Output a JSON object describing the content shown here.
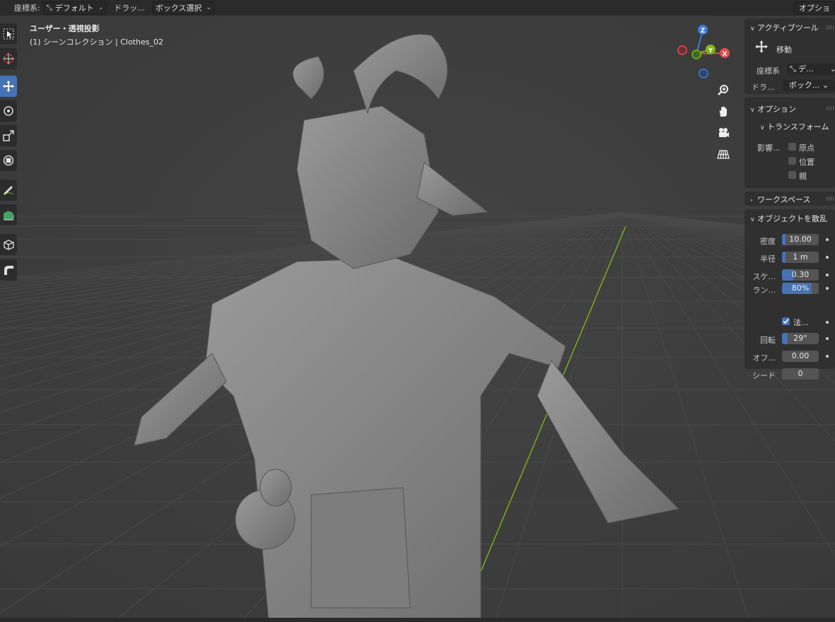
{
  "header": {
    "coord_label": "座標系:",
    "coord_value": "デフォルト",
    "drag_label": "ドラッ...",
    "drag_value": "ボックス選択",
    "options_label": "オプショ"
  },
  "viewport": {
    "view_title": "ユーザー・透視投影",
    "collection_info": "(1) シーンコレクション | Clothes_02"
  },
  "toolbar": {
    "tools": [
      "select-box",
      "cursor",
      "move",
      "rotate",
      "scale",
      "transform",
      "annotate",
      "measure",
      "add-cube",
      "extrude"
    ],
    "active_tool": "move"
  },
  "gizmo": {
    "z_label": "Z",
    "y_label": "Y",
    "x_label": "X",
    "colors": {
      "x": "#e24d4d",
      "y": "#7cb518",
      "z": "#3b7dd8"
    }
  },
  "nav_buttons": [
    "zoom-icon",
    "pan-hand-icon",
    "camera-icon",
    "grid-ortho-icon"
  ],
  "sidebar": {
    "active_tool_header": "アクティブツール",
    "tool_name": "移動",
    "coord_label": "座標系",
    "coord_value": "デ...",
    "drag_label": "ドラ...",
    "drag_value": "ボック...",
    "options_header": "オプション",
    "transform_header": "トランスフォーム",
    "affect_label": "影響...",
    "affect_options": [
      {
        "label": "原点",
        "checked": false
      },
      {
        "label": "位置",
        "checked": false
      },
      {
        "label": "親",
        "checked": false
      }
    ],
    "workspace_header": "ワークスペース",
    "scatter_header": "オブジェクトを散乱",
    "scatter_fields": [
      {
        "label": "密度",
        "value": "10.00",
        "fill": 0.1
      },
      {
        "label": "半径",
        "value": "1 m",
        "fill": 0.1
      },
      {
        "label": "スケ...",
        "value": "0.30",
        "fill": 0.3
      },
      {
        "label": "ラン...",
        "value": "80%",
        "fill": 0.8
      }
    ],
    "normal_label": "法...",
    "normal_checked": true,
    "scatter_fields2": [
      {
        "label": "回転",
        "value": "29°",
        "fill": 0.16
      },
      {
        "label": "オフ...",
        "value": "0.00",
        "fill": 0.0
      },
      {
        "label": "シード",
        "value": "0",
        "fill": 0.0
      }
    ]
  },
  "colors": {
    "accent": "#4772b3",
    "background": "#3f3f3f",
    "y_axis_line": "#7cb518"
  }
}
